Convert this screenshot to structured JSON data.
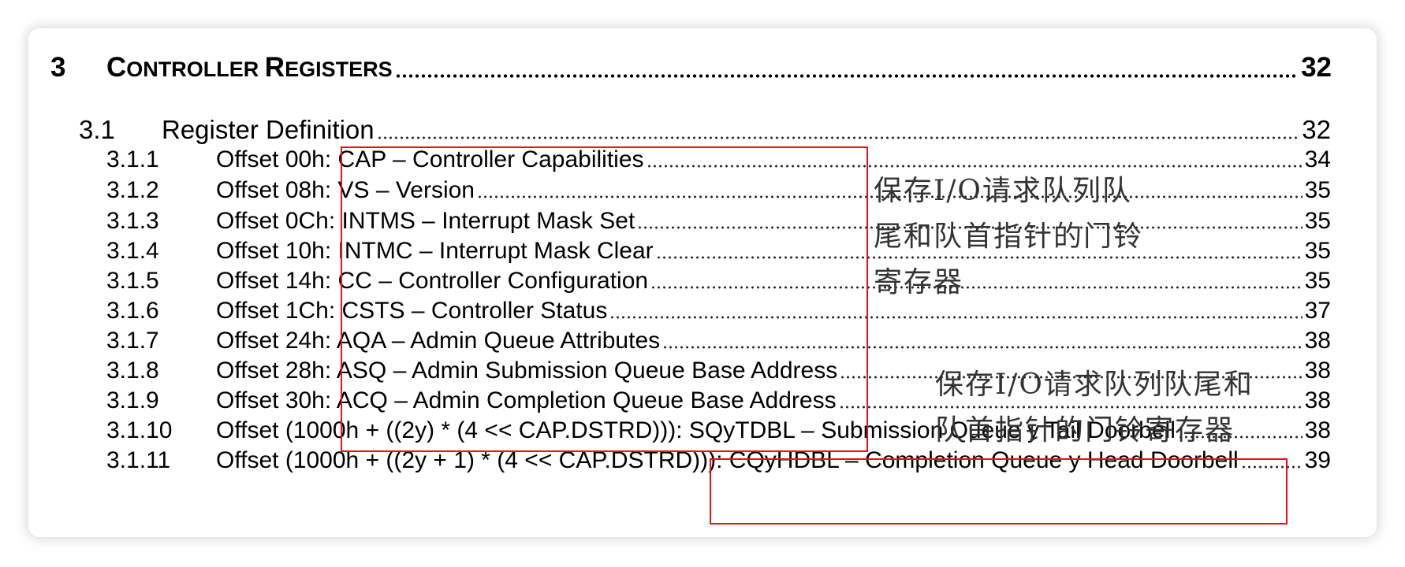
{
  "heading": {
    "number": "3",
    "title_cap1": "C",
    "title_rest1": "ONTROLLER ",
    "title_cap2": "R",
    "title_rest2": "EGISTERS",
    "page": "32"
  },
  "section": {
    "number": "3.1",
    "title": "Register Definition",
    "page": "32"
  },
  "entries": [
    {
      "number": "3.1.1",
      "title": "Offset 00h: CAP – Controller Capabilities",
      "page": "34"
    },
    {
      "number": "3.1.2",
      "title": "Offset 08h: VS – Version",
      "page": "35"
    },
    {
      "number": "3.1.3",
      "title": "Offset 0Ch: INTMS – Interrupt Mask Set",
      "page": "35"
    },
    {
      "number": "3.1.4",
      "title": "Offset 10h: INTMC – Interrupt Mask Clear",
      "page": "35"
    },
    {
      "number": "3.1.5",
      "title": "Offset 14h: CC – Controller Configuration",
      "page": "35"
    },
    {
      "number": "3.1.6",
      "title": "Offset 1Ch: CSTS – Controller Status",
      "page": "37"
    },
    {
      "number": "3.1.7",
      "title": "Offset 24h: AQA – Admin Queue Attributes",
      "page": "38"
    },
    {
      "number": "3.1.8",
      "title": "Offset 28h: ASQ – Admin Submission Queue Base Address",
      "page": "38"
    },
    {
      "number": "3.1.9",
      "title": "Offset 30h: ACQ – Admin Completion Queue Base Address",
      "page": "38"
    },
    {
      "number": "3.1.10",
      "title": "Offset (1000h + ((2y) * (4 << CAP.DSTRD))): SQyTDBL – Submission Queue y Tail Doorbell",
      "page": "38"
    },
    {
      "number": "3.1.11",
      "title": "Offset (1000h + ((2y + 1) * (4 << CAP.DSTRD))): CQyHDBL – Completion Queue y Head Doorbell",
      "page": "39"
    }
  ],
  "annotations": {
    "note1": [
      "保存I/O请求队列队",
      "尾和队首指针的门铃",
      "寄存器"
    ],
    "note2": [
      "保存I/O请求队列队尾和",
      "队首指针的门铃寄存器"
    ]
  },
  "colors": {
    "highlight_box": "#e8101a",
    "note_text": "#333333"
  }
}
